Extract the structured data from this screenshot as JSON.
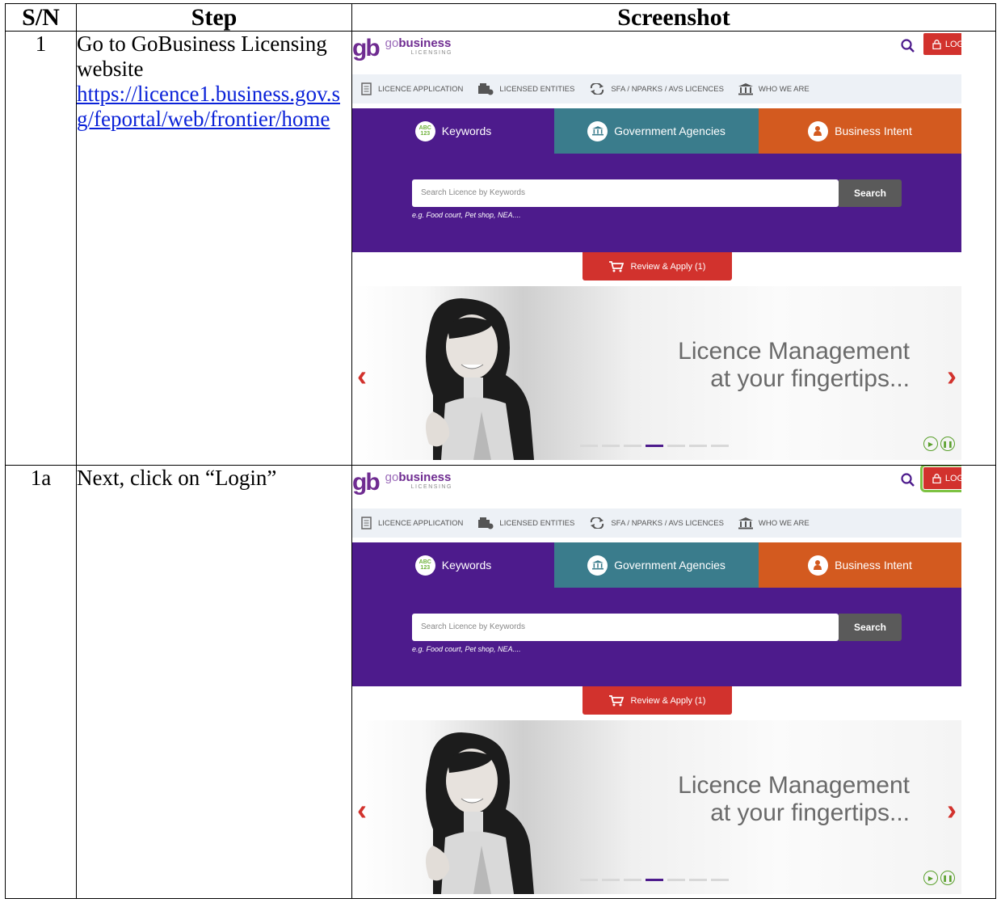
{
  "table": {
    "headers": {
      "sn": "S/N",
      "step": "Step",
      "screenshot": "Screenshot"
    },
    "rows": [
      {
        "sn": "1",
        "step_text": "Go to GoBusiness Licensing website",
        "link": "https://licence1.business.gov.sg/feportal/web/frontier/home"
      },
      {
        "sn": "1a",
        "step_text": "Next, click on “Login”"
      }
    ]
  },
  "site": {
    "logo_mark": "gb",
    "logo_go": "go",
    "logo_business": "business",
    "logo_sub": "LICENSING",
    "login_label": "LOGIN",
    "nav": [
      "LICENCE APPLICATION",
      "LICENSED ENTITIES",
      "SFA / NPARKS / AVS LICENCES",
      "WHO WE ARE"
    ],
    "tabs": [
      "Keywords",
      "Government Agencies",
      "Business Intent"
    ],
    "keyword_icon_text": "ABC 123",
    "search_placeholder": "Search Licence by Keywords",
    "search_button": "Search",
    "search_hint": "e.g. Food court, Pet shop, NEA....",
    "review_label": "Review & Apply (1)",
    "banner_line1": "Licence Management",
    "banner_line2": "at your fingertips...",
    "prev_arrow": "‹",
    "next_arrow": "›",
    "colors": {
      "purple": "#4d1b8c",
      "teal": "#3a7c8c",
      "orange": "#d35a1f",
      "red": "#d2322d",
      "highlight": "#7dc242"
    }
  }
}
